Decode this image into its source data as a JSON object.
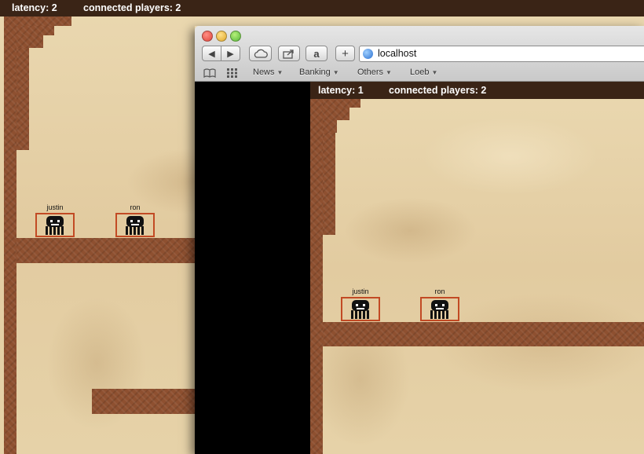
{
  "outer_game": {
    "latency_label": "latency: 2",
    "connected_label": "connected players:  2",
    "players": [
      {
        "name": "justin"
      },
      {
        "name": "ron"
      }
    ]
  },
  "browser": {
    "url": "localhost",
    "toolbar": {
      "back_icon": "back-arrow-icon",
      "forward_icon": "forward-arrow-icon",
      "cloud_icon": "icloud-icon",
      "share_icon": "share-icon",
      "amazon_label": "a",
      "add_label": "+"
    },
    "bookmarks": [
      "News",
      "Banking",
      "Others",
      "Loeb"
    ],
    "inner_game": {
      "latency_label": "latency: 1",
      "connected_label": "connected players:  2",
      "players": [
        {
          "name": "justin"
        },
        {
          "name": "ron"
        }
      ]
    }
  },
  "colors": {
    "brick": "#8e5030",
    "parchment": "#e8d5ac",
    "hud_bar": "#3a2416",
    "player_box": "#c24a24"
  }
}
